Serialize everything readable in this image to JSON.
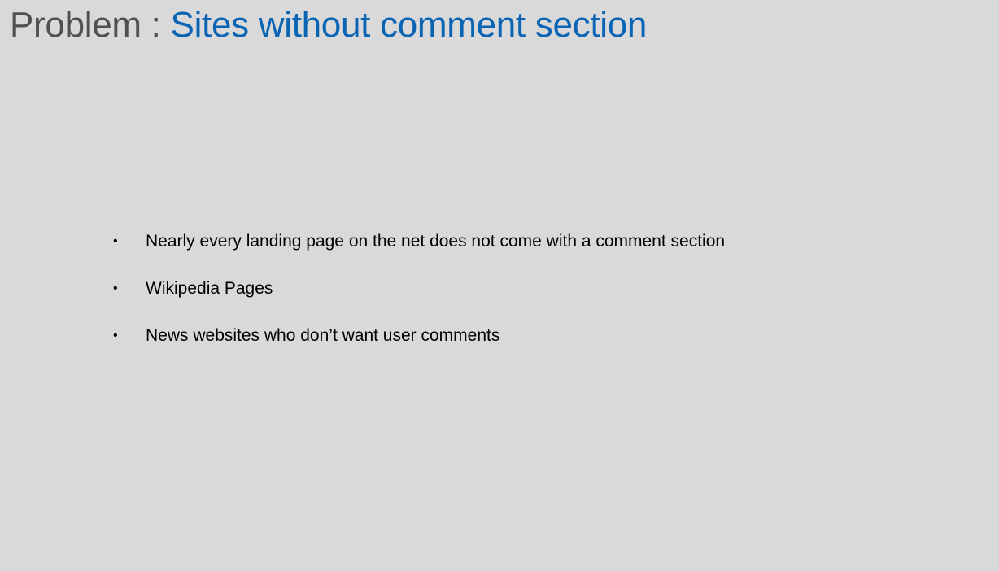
{
  "slide": {
    "title_prefix": "Problem : ",
    "title_main": "Sites without comment section",
    "bullets": [
      "Nearly every landing page on the net does not come with a comment section",
      "Wikipedia Pages",
      "News websites who don’t want user comments"
    ],
    "bullet_marker": "•",
    "colors": {
      "background": "#d9d9d9",
      "title_prefix": "#505050",
      "title_main": "#0a64b4",
      "body_text": "#000000"
    }
  }
}
